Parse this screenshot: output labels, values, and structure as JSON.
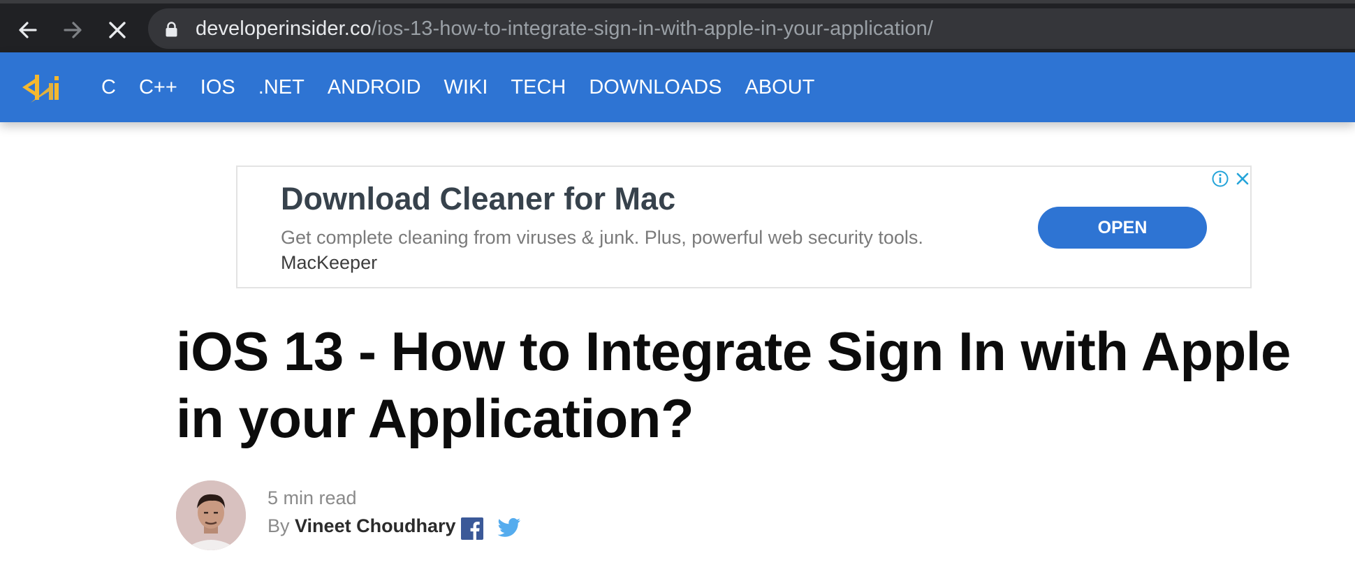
{
  "browser": {
    "url_domain": "developerinsider.co",
    "url_path": "/ios-13-how-to-integrate-sign-in-with-apple-in-your-application/",
    "back_icon": "arrow-left-icon",
    "forward_icon": "arrow-right-icon",
    "stop_icon": "close-icon",
    "lock_icon": "lock-icon"
  },
  "site": {
    "brand_color": "#2e74d3",
    "logo_icon": "developerinsider-logo",
    "nav": [
      "C",
      "C++",
      "IOS",
      ".NET",
      "ANDROID",
      "WIKI",
      "TECH",
      "DOWNLOADS",
      "ABOUT"
    ]
  },
  "ad": {
    "title": "Download Cleaner for Mac",
    "description": "Get complete cleaning from viruses & junk. Plus, powerful web security tools.",
    "brand": "MacKeeper",
    "cta_label": "OPEN",
    "info_icon": "info-icon",
    "close_icon": "close-icon"
  },
  "article": {
    "title": "iOS 13 - How to Integrate Sign In with Apple in your Application?",
    "read_time": "5 min read",
    "by_label": "By",
    "author": "Vineet Choudhary",
    "social_icons": [
      "facebook-icon",
      "twitter-icon"
    ]
  }
}
